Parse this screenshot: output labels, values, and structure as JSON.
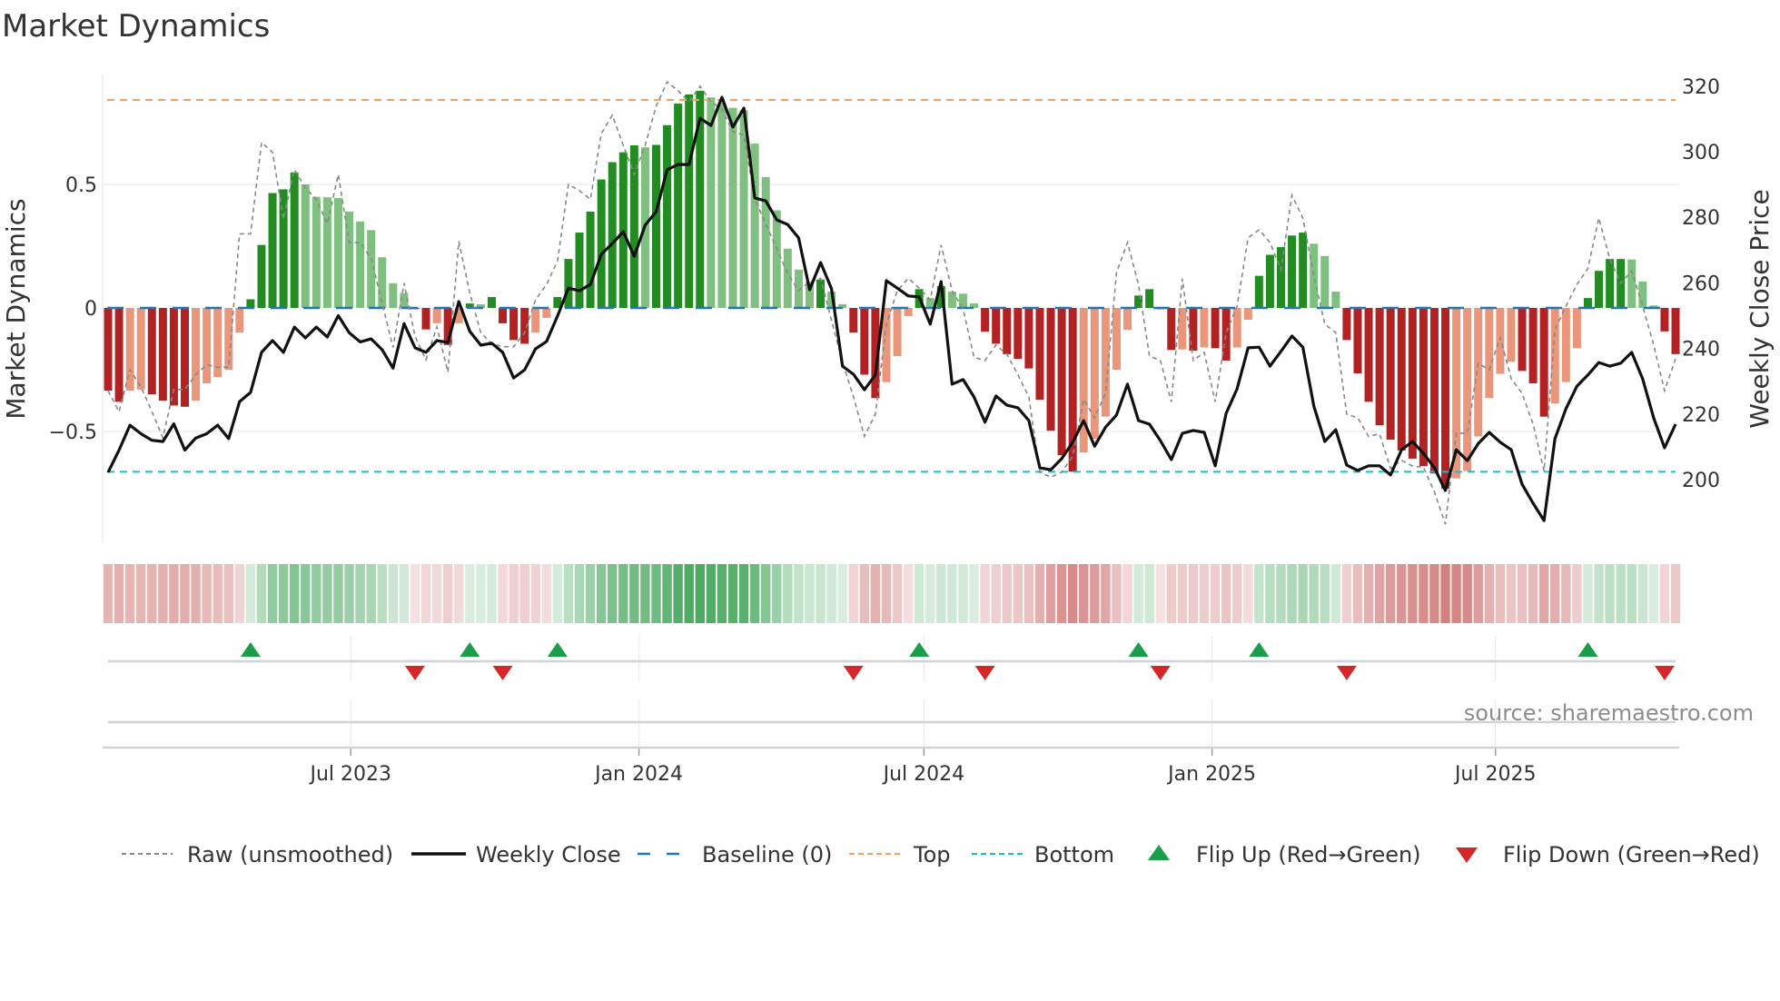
{
  "chart_data": {
    "type": "bar",
    "title": "Market Dynamics",
    "ylabel": "Market Dynamics",
    "ylabel_right": "Weekly Close Price",
    "source": "source: sharemaestro.com",
    "x_start": "2023-01-27",
    "x_step_days": 7,
    "x_ticks": [
      {
        "label": "Jul 2023",
        "date": "2023-07-01"
      },
      {
        "label": "Jan 2024",
        "date": "2024-01-01"
      },
      {
        "label": "Jul 2024",
        "date": "2024-07-01"
      },
      {
        "label": "Jan 2025",
        "date": "2025-01-01"
      },
      {
        "label": "Jul 2025",
        "date": "2025-07-01"
      }
    ],
    "y_left": {
      "ylim": [
        -0.9,
        0.95
      ],
      "ticks": [
        0.5,
        0,
        -0.5
      ],
      "tick_labels": [
        "0.5",
        "0",
        "−0.5"
      ]
    },
    "y_right": {
      "ylim": [
        184,
        324
      ],
      "ticks": [
        320,
        300,
        280,
        260,
        240,
        220,
        200
      ],
      "tick_labels": [
        "320",
        "300",
        "280",
        "260",
        "240",
        "220",
        "200"
      ]
    },
    "levels": {
      "baseline": 0,
      "top": 0.842,
      "bottom": -0.663
    },
    "colors": {
      "up_strong": "#228b22",
      "up_weak": "#7fbf7f",
      "down_strong": "#b22222",
      "down_weak": "#e9967a",
      "raw": "#888888",
      "close": "#111111",
      "baseline": "#1f77b4",
      "top": "#f4a460",
      "bottom": "#17becf",
      "flip_up": "#1a9e4a",
      "flip_down": "#d62728",
      "heat_green": "#34a04e",
      "heat_red": "#c65a58"
    },
    "series": [
      {
        "name": "Market Dynamics",
        "values": [
          -0.335,
          -0.38,
          -0.335,
          -0.33,
          -0.35,
          -0.375,
          -0.395,
          -0.4,
          -0.375,
          -0.305,
          -0.28,
          -0.25,
          -0.1,
          0.035,
          0.255,
          0.465,
          0.48,
          0.548,
          0.5,
          0.45,
          0.448,
          0.445,
          0.39,
          0.35,
          0.315,
          0.205,
          0.1,
          0.06,
          -0.005,
          -0.087,
          -0.062,
          -0.15,
          -0.062,
          0.018,
          0.015,
          0.044,
          -0.062,
          -0.13,
          -0.145,
          -0.1,
          -0.04,
          0.044,
          0.198,
          0.305,
          0.39,
          0.52,
          0.59,
          0.63,
          0.658,
          0.65,
          0.66,
          0.74,
          0.827,
          0.864,
          0.879,
          0.852,
          0.83,
          0.81,
          0.8,
          0.665,
          0.53,
          0.395,
          0.24,
          0.155,
          0.106,
          0.115,
          0.066,
          0.015,
          -0.1,
          -0.27,
          -0.365,
          -0.3,
          -0.195,
          -0.033,
          0.076,
          0.04,
          0.088,
          0.066,
          0.058,
          0.018,
          -0.096,
          -0.145,
          -0.187,
          -0.206,
          -0.245,
          -0.372,
          -0.497,
          -0.596,
          -0.663,
          -0.585,
          -0.53,
          -0.44,
          -0.25,
          -0.088,
          0.05,
          0.076,
          -0.005,
          -0.17,
          -0.168,
          -0.173,
          -0.16,
          -0.163,
          -0.213,
          -0.16,
          -0.048,
          0.13,
          0.215,
          0.246,
          0.293,
          0.305,
          0.26,
          0.21,
          0.066,
          -0.13,
          -0.265,
          -0.38,
          -0.475,
          -0.533,
          -0.577,
          -0.61,
          -0.64,
          -0.67,
          -0.732,
          -0.69,
          -0.66,
          -0.52,
          -0.365,
          -0.267,
          -0.218,
          -0.255,
          -0.305,
          -0.44,
          -0.387,
          -0.3,
          -0.163,
          0.04,
          0.15,
          0.198,
          0.198,
          0.196,
          0.107,
          0.01,
          -0.095,
          -0.187
        ]
      },
      {
        "name": "Raw (unsmoothed)",
        "values": [
          -0.335,
          -0.42,
          -0.25,
          -0.32,
          -0.42,
          -0.525,
          -0.33,
          -0.33,
          -0.27,
          -0.23,
          -0.24,
          -0.24,
          0.3,
          0.3,
          0.67,
          0.63,
          0.36,
          0.56,
          0.485,
          0.44,
          0.34,
          0.54,
          0.265,
          0.265,
          0.2,
          0.02,
          -0.16,
          0.1,
          -0.115,
          -0.21,
          -0.077,
          -0.26,
          0.27,
          0.06,
          -0.1,
          -0.145,
          -0.157,
          -0.157,
          -0.1,
          0.033,
          0.095,
          0.19,
          0.5,
          0.475,
          0.44,
          0.705,
          0.78,
          0.658,
          0.54,
          0.658,
          0.816,
          0.915,
          0.879,
          0.835,
          0.897,
          0.835,
          0.805,
          0.713,
          0.7,
          0.44,
          0.34,
          0.24,
          0.14,
          0.07,
          0.106,
          0.12,
          -0.05,
          -0.22,
          -0.36,
          -0.52,
          -0.43,
          -0.065,
          0.07,
          0.12,
          0.08,
          0.033,
          0.254,
          0.07,
          -0.004,
          -0.2,
          -0.213,
          -0.15,
          -0.187,
          -0.27,
          -0.36,
          -0.665,
          -0.685,
          -0.665,
          -0.6,
          -0.37,
          -0.445,
          -0.345,
          0.143,
          0.265,
          0.095,
          -0.195,
          -0.213,
          -0.38,
          0.118,
          -0.213,
          -0.18,
          -0.38,
          -0.1,
          0.007,
          0.283,
          0.316,
          0.265,
          0.155,
          0.456,
          0.364,
          0.13,
          -0.066,
          -0.1,
          -0.43,
          -0.445,
          -0.52,
          -0.51,
          -0.65,
          -0.617,
          -0.64,
          -0.645,
          -0.745,
          -0.875,
          -0.507,
          -0.507,
          -0.224,
          -0.25,
          -0.12,
          -0.286,
          -0.346,
          -0.47,
          -0.66,
          -0.088,
          0.007,
          0.095,
          0.16,
          0.364,
          0.198,
          0.1,
          0.15,
          0.007,
          -0.15,
          -0.335,
          -0.206
        ]
      },
      {
        "name": "Weekly Close",
        "axis": "right",
        "values": [
          202.2,
          209,
          216.6,
          214,
          212,
          211.6,
          217,
          209,
          212.7,
          214,
          216.6,
          212.5,
          223.8,
          226.6,
          238.8,
          242.4,
          238.8,
          246.5,
          243.2,
          246.5,
          243.5,
          250,
          244.8,
          242,
          242.9,
          239.6,
          234,
          247.6,
          240.2,
          238.8,
          242.4,
          241.8,
          254.3,
          245.2,
          241,
          241.6,
          238.8,
          231,
          233.5,
          239.9,
          242.1,
          249.9,
          258.4,
          257.6,
          259.5,
          268.7,
          272,
          275.6,
          268.1,
          277.6,
          281.7,
          294.5,
          296.1,
          296.1,
          310.2,
          308,
          316.6,
          307.5,
          313.3,
          285.9,
          285,
          279.2,
          277.8,
          273.7,
          257.9,
          266.2,
          258.2,
          234.6,
          232.1,
          227.4,
          231.9,
          260.7,
          258.4,
          256,
          255.7,
          247.4,
          260.4,
          229.1,
          230.5,
          225.2,
          217.5,
          225.5,
          222.7,
          221.9,
          218,
          203.6,
          203,
          206.4,
          211.4,
          218,
          210.2,
          216,
          219.7,
          229.1,
          218,
          216.9,
          211.9,
          206.1,
          214.1,
          215,
          214.4,
          204.2,
          220.2,
          227.7,
          240.2,
          240.4,
          234.6,
          239.1,
          243.8,
          240.4,
          222.4,
          211.6,
          215.2,
          204.4,
          202.8,
          204.2,
          204.2,
          201.4,
          209.1,
          211.6,
          208,
          203.6,
          196.7,
          209.1,
          205.8,
          211,
          214.4,
          211.4,
          209.1,
          198.6,
          192.8,
          187.5,
          212.5,
          221.6,
          228.5,
          231.9,
          235.7,
          234.6,
          235.5,
          238.8,
          230.7,
          218.8,
          209.7,
          216.9
        ]
      }
    ],
    "flips": {
      "up_week_index": [
        14,
        34,
        42,
        75,
        95,
        106,
        136
      ],
      "down_week_index": [
        29,
        37,
        69,
        81,
        97,
        114,
        143
      ]
    },
    "legend": {
      "placement": "bottom",
      "items": [
        {
          "label": "Raw (unsmoothed)",
          "key": "raw"
        },
        {
          "label": "Weekly Close",
          "key": "close"
        },
        {
          "label": "Baseline (0)",
          "key": "baseline"
        },
        {
          "label": "Top",
          "key": "top"
        },
        {
          "label": "Bottom",
          "key": "bottom"
        },
        {
          "label": "Flip Up (Red→Green)",
          "key": "flip_up"
        },
        {
          "label": "Flip Down (Green→Red)",
          "key": "flip_down"
        }
      ]
    }
  }
}
